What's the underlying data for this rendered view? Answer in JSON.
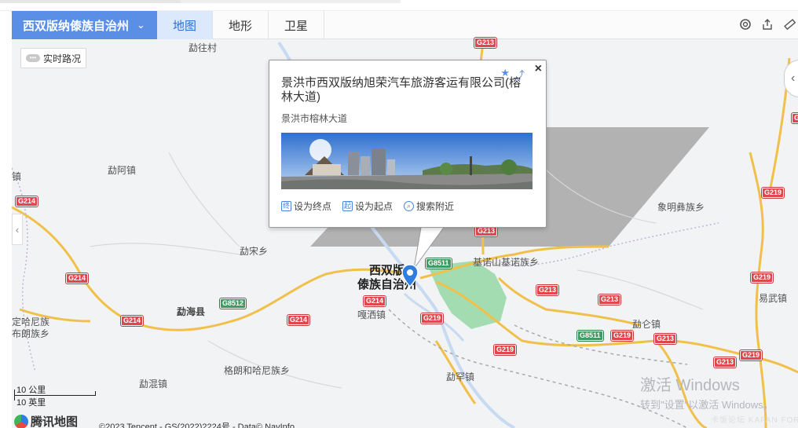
{
  "toolbar": {
    "region": "西双版纳傣族自治州",
    "region_chevron": "⌄",
    "tabs": [
      {
        "label": "地图"
      },
      {
        "label": "地形"
      },
      {
        "label": "卫星"
      }
    ]
  },
  "controls": {
    "traffic_label": "实时路况",
    "traffic_dots": "•••",
    "left_arrow": "‹",
    "right_arrow": "‹"
  },
  "popup": {
    "title": "景洪市西双版纳旭荣汽车旅游客运有限公司(榕林大道)",
    "address": "景洪市榕林大道",
    "actions": [
      {
        "icon": "终",
        "label": "设为终点"
      },
      {
        "icon": "起",
        "label": "设为起点"
      },
      {
        "icon": "⌕",
        "label": "搜索附近"
      }
    ],
    "close": "×",
    "fav": "★",
    "share": "⤴"
  },
  "places": {
    "menghai_county": "勐海县",
    "menghan_town": "勐罕镇",
    "mengwang": "勐往村",
    "menga": "勐阿镇",
    "mengsong": "勐宋乡",
    "menghun": "勐混镇",
    "gelanghe": "格朗和哈尼族乡",
    "jinuoshan": "基诺山基诺族乡",
    "xiangming": "象明彝族乡",
    "mengyang": "勐仑镇",
    "yiwu": "易武镇",
    "dinghaniz_1": "定哈尼族",
    "dinghaniz_2": "布朗族乡",
    "left_edge_town": "镇",
    "mengla_edge": "勐罕镇",
    "gasa": "嘎洒镇",
    "city_line1": "西双版",
    "city_line2": "傣族自治州"
  },
  "shields": [
    {
      "text": "G213"
    },
    {
      "text": "G214"
    },
    {
      "text": "G214"
    },
    {
      "text": "G214"
    },
    {
      "text": "G214"
    },
    {
      "text": "G214"
    },
    {
      "text": "G219"
    },
    {
      "text": "G219"
    },
    {
      "text": "G219"
    },
    {
      "text": "G219"
    },
    {
      "text": "G219"
    },
    {
      "text": "G219"
    },
    {
      "text": "G213"
    },
    {
      "text": "G213"
    },
    {
      "text": "G213"
    },
    {
      "text": "G213"
    },
    {
      "text": "G213"
    },
    {
      "text": "G213"
    },
    {
      "text": "G8511"
    },
    {
      "text": "G8511"
    },
    {
      "text": "G8512"
    },
    {
      "text": "G219"
    },
    {
      "text": "G219"
    }
  ],
  "scale": {
    "km": "10 公里",
    "mi": "10 英里"
  },
  "logo_text": "腾讯地图",
  "copyright": "©2023 Tencent - GS(2022)2224号 - Data© NavInfo",
  "watermark": {
    "line1": "激活 Windows",
    "line2": "转到\"设置\"以激活 Windows。"
  },
  "forum_mark": "卡饭论坛 KAFAN FORUM"
}
